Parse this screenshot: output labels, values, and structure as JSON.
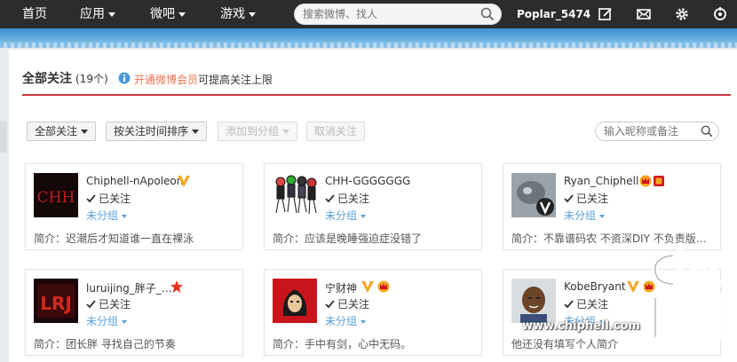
{
  "nav": {
    "home": "首页",
    "apps": "应用",
    "weiba": "微吧",
    "games": "游戏",
    "search_placeholder": "搜索微博、找人",
    "username": "Poplar_5474"
  },
  "header": {
    "title": "全部关注",
    "count": "(19个)",
    "vip_link": "开通微博会员",
    "vip_tip": "可提高关注上限"
  },
  "toolbar": {
    "all_follow": "全部关注",
    "sort": "按关注时间排序",
    "add_group": "添加到分组",
    "unfollow": "取消关注",
    "filter_placeholder": "输入昵称或备注"
  },
  "cards": [
    {
      "nick": "Chiphell-nApoleon",
      "status": "已关注",
      "group": "未分组",
      "bio": "简介：迟潮后才知道谁一直在裸泳"
    },
    {
      "nick": "CHH-GGGGGGG",
      "status": "已关注",
      "group": "未分组",
      "bio": "简介：应该是晚睡强迫症没错了"
    },
    {
      "nick": "Ryan_Chiphell",
      "status": "已关注",
      "group": "未分组",
      "bio": "简介：不靠谱码农 不资深DIY 不负责版…"
    },
    {
      "nick": "luruijing_胖子_…",
      "status": "已关注",
      "group": "未分组",
      "bio": "简介：团长胖 寻找自己的节奏"
    },
    {
      "nick": "宁财神",
      "status": "已关注",
      "group": "未分组",
      "bio": "简介：手中有剑，心中无码。"
    },
    {
      "nick": "KobeBryant",
      "status": "已关注",
      "group": "未分组",
      "bio": "他还没有填写个人简介"
    }
  ],
  "avatar_texts": {
    "chh": "CHH",
    "lrj": "LRJ"
  },
  "watermark": {
    "url": "www.chiphell.com",
    "logo": "chip hell"
  },
  "colors": {
    "accent_red": "#c8383b",
    "link_blue": "#5aa1d8",
    "vip_orange": "#eb7350",
    "verified_gold": "#f5a623"
  }
}
